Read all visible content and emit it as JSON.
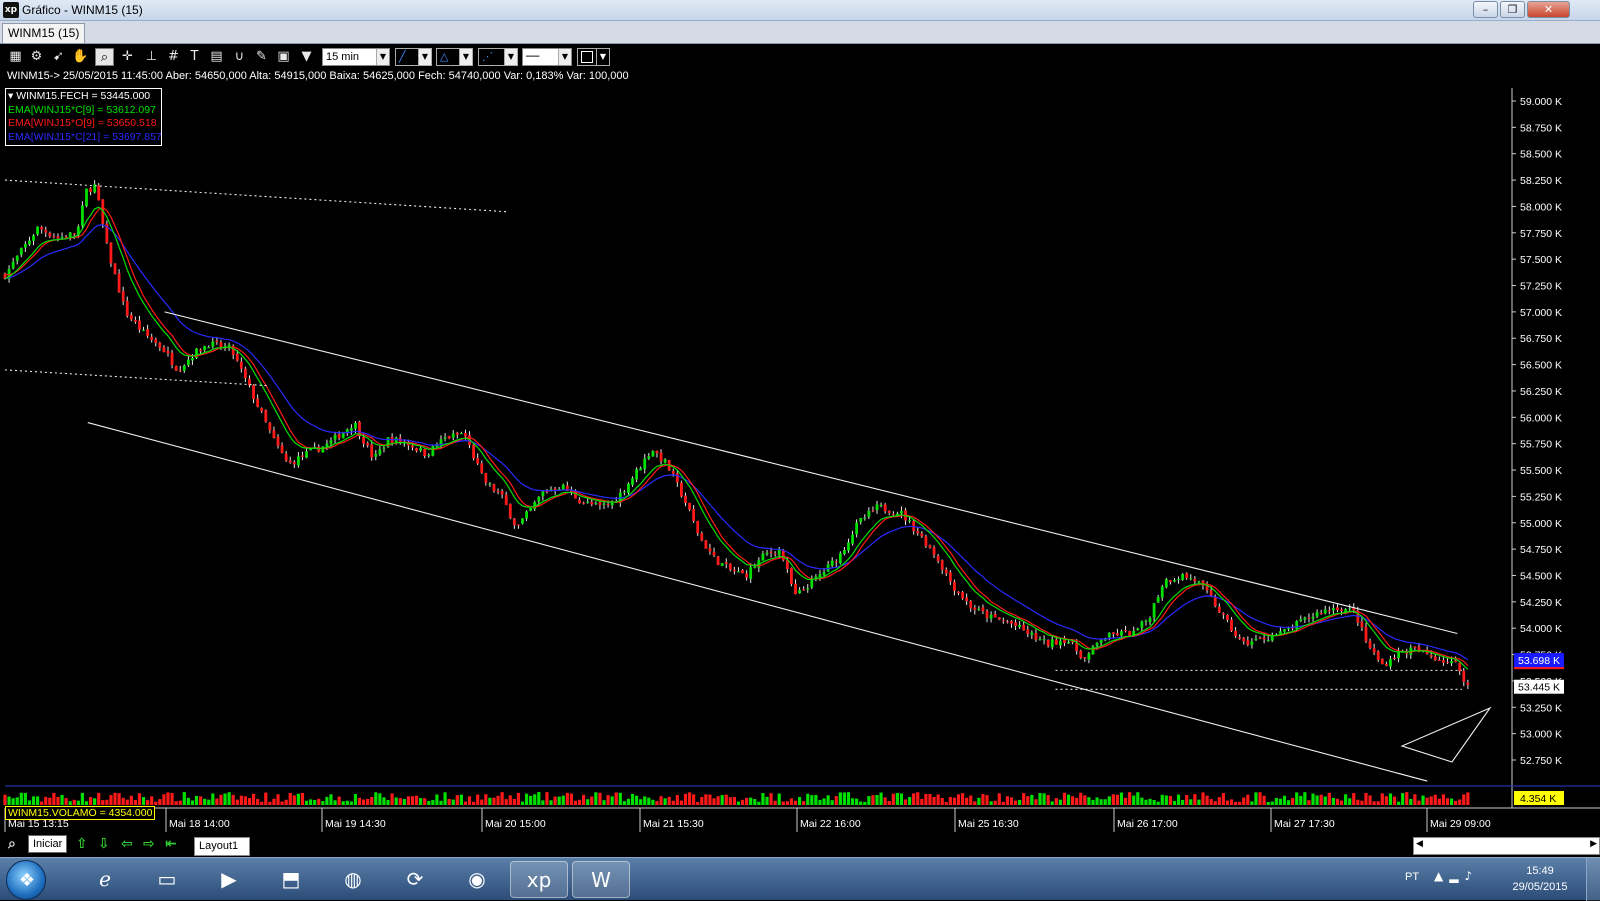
{
  "window": {
    "title": "Gráfico - WINM15 (15)",
    "icon": "xp-logo-icon",
    "minimize": "–",
    "maximize": "❐",
    "close": "✕"
  },
  "tab": {
    "label": "WINM15 (15)"
  },
  "toolbar": {
    "timeframe": "15 min"
  },
  "info_line": "WINM15-> 25/05/2015 11:45:00 Aber: 54650,000 Alta: 54915,000 Baixa: 54625,000 Fech: 54740,000 Var: 0,183% Var: 100,000",
  "legend": {
    "items": [
      {
        "text": "▾ WINM15.FECH = 53445.000",
        "color": "#ffffff"
      },
      {
        "text": "EMA[WINJ15*C[9] = 53612.097",
        "color": "#00e000"
      },
      {
        "text": "EMA[WINJ15*O[9] = 53650.518",
        "color": "#ff1a1a"
      },
      {
        "text": "EMA[WINJ15*C[21] = 53697.857",
        "color": "#2a2aff"
      }
    ]
  },
  "volume_label": "WINM15.VOLAMO = 4354.000",
  "bottom": {
    "iniciar": "Iniciar",
    "layout_tab": "Layout1"
  },
  "taskbar": {
    "lang": "PT",
    "time": "15:49",
    "date": "29/05/2015"
  },
  "colors": {
    "up": "#00e000",
    "down": "#ff1a1a",
    "ema_open": "#ff1a1a",
    "ema_long": "#2a2aff",
    "current_price_box": "#1a1aff",
    "last_close_box": "#ffffff",
    "volume_box": "#ffff00"
  },
  "chart_data": {
    "type": "candlestick",
    "symbol": "WINM15",
    "timeframe": "15 min",
    "y_axis": {
      "side": "right",
      "range": [
        52500,
        59200
      ],
      "ticks": [
        "59.000 K",
        "58.750 K",
        "58.500 K",
        "58.250 K",
        "58.000 K",
        "57.750 K",
        "57.500 K",
        "57.250 K",
        "57.000 K",
        "56.750 K",
        "56.500 K",
        "56.250 K",
        "56.000 K",
        "55.750 K",
        "55.500 K",
        "55.250 K",
        "55.000 K",
        "54.750 K",
        "54.500 K",
        "54.250 K",
        "54.000 K",
        "53.750 K",
        "53.500 K",
        "53.250 K",
        "53.000 K",
        "52.750 K"
      ],
      "tick_values": [
        59000,
        58750,
        58500,
        58250,
        58000,
        57750,
        57500,
        57250,
        57000,
        56750,
        56500,
        56250,
        56000,
        55750,
        55500,
        55250,
        55000,
        54750,
        54500,
        54250,
        54000,
        53750,
        53500,
        53250,
        53000,
        52750
      ]
    },
    "x_axis": {
      "labels": [
        "Mai 15 13:15",
        "Mai 18 14:00",
        "Mai 19 14:30",
        "Mai 20 15:00",
        "Mai 21 15:30",
        "Mai 22 16:00",
        "Mai 25 16:30",
        "Mai 26 17:00",
        "Mai 27 17:30",
        "Mai 29 09:00"
      ]
    },
    "close_path": [
      [
        0.0,
        57350
      ],
      [
        0.012,
        57600
      ],
      [
        0.022,
        57800
      ],
      [
        0.035,
        57700
      ],
      [
        0.048,
        57750
      ],
      [
        0.054,
        58150
      ],
      [
        0.06,
        58200
      ],
      [
        0.068,
        57600
      ],
      [
        0.08,
        57000
      ],
      [
        0.092,
        56800
      ],
      [
        0.105,
        56650
      ],
      [
        0.115,
        56450
      ],
      [
        0.125,
        56600
      ],
      [
        0.135,
        56700
      ],
      [
        0.15,
        56650
      ],
      [
        0.165,
        56200
      ],
      [
        0.178,
        55800
      ],
      [
        0.188,
        55550
      ],
      [
        0.2,
        55650
      ],
      [
        0.215,
        55750
      ],
      [
        0.232,
        55950
      ],
      [
        0.245,
        55600
      ],
      [
        0.255,
        55800
      ],
      [
        0.268,
        55750
      ],
      [
        0.28,
        55650
      ],
      [
        0.292,
        55800
      ],
      [
        0.305,
        55850
      ],
      [
        0.318,
        55400
      ],
      [
        0.33,
        55250
      ],
      [
        0.34,
        54950
      ],
      [
        0.348,
        55100
      ],
      [
        0.358,
        55300
      ],
      [
        0.37,
        55350
      ],
      [
        0.383,
        55200
      ],
      [
        0.395,
        55150
      ],
      [
        0.405,
        55200
      ],
      [
        0.418,
        55450
      ],
      [
        0.43,
        55700
      ],
      [
        0.44,
        55550
      ],
      [
        0.452,
        55200
      ],
      [
        0.462,
        54850
      ],
      [
        0.472,
        54650
      ],
      [
        0.482,
        54550
      ],
      [
        0.492,
        54500
      ],
      [
        0.505,
        54700
      ],
      [
        0.515,
        54750
      ],
      [
        0.525,
        54300
      ],
      [
        0.533,
        54400
      ],
      [
        0.545,
        54550
      ],
      [
        0.555,
        54700
      ],
      [
        0.567,
        55000
      ],
      [
        0.58,
        55150
      ],
      [
        0.595,
        55100
      ],
      [
        0.607,
        54900
      ],
      [
        0.618,
        54700
      ],
      [
        0.63,
        54400
      ],
      [
        0.642,
        54200
      ],
      [
        0.655,
        54100
      ],
      [
        0.668,
        54050
      ],
      [
        0.68,
        53950
      ],
      [
        0.692,
        53850
      ],
      [
        0.705,
        53900
      ],
      [
        0.718,
        53700
      ],
      [
        0.728,
        53900
      ],
      [
        0.74,
        53950
      ],
      [
        0.75,
        53950
      ],
      [
        0.76,
        54100
      ],
      [
        0.77,
        54450
      ],
      [
        0.782,
        54500
      ],
      [
        0.792,
        54450
      ],
      [
        0.803,
        54250
      ],
      [
        0.812,
        54050
      ],
      [
        0.822,
        53850
      ],
      [
        0.835,
        53900
      ],
      [
        0.848,
        53950
      ],
      [
        0.86,
        54050
      ],
      [
        0.873,
        54150
      ],
      [
        0.885,
        54200
      ],
      [
        0.897,
        54150
      ],
      [
        0.905,
        53850
      ],
      [
        0.915,
        53650
      ],
      [
        0.925,
        53750
      ],
      [
        0.935,
        53800
      ],
      [
        0.945,
        53750
      ],
      [
        0.955,
        53700
      ],
      [
        0.965,
        53650
      ],
      [
        0.972,
        53450
      ]
    ],
    "close_path_x_unit": "fraction of visible time range",
    "last_values": {
      "close": 53445,
      "ema_c9": 53612.097,
      "ema_o9": 53650.518,
      "ema_c21": 53697.857
    },
    "price_badges": [
      "53.698 K",
      "53.445 K"
    ],
    "trend_lines": [
      {
        "style": "solid",
        "from": [
          0.106,
          57000
        ],
        "to": [
          0.965,
          53950
        ]
      },
      {
        "style": "solid",
        "from": [
          0.055,
          55950
        ],
        "to": [
          0.945,
          52550
        ]
      },
      {
        "style": "dotted",
        "from": [
          0.0,
          58250
        ],
        "to": [
          0.333,
          57950
        ]
      },
      {
        "style": "dotted",
        "from": [
          0.0,
          56450
        ],
        "to": [
          0.175,
          56300
        ]
      },
      {
        "style": "dotted",
        "from": [
          0.698,
          53600
        ],
        "to": [
          0.968,
          53600
        ]
      },
      {
        "style": "dotted",
        "from": [
          0.698,
          53420
        ],
        "to": [
          0.968,
          53420
        ]
      }
    ],
    "volume_axis_label": "4.354 K",
    "grid": false,
    "legend_position": "top-left"
  }
}
